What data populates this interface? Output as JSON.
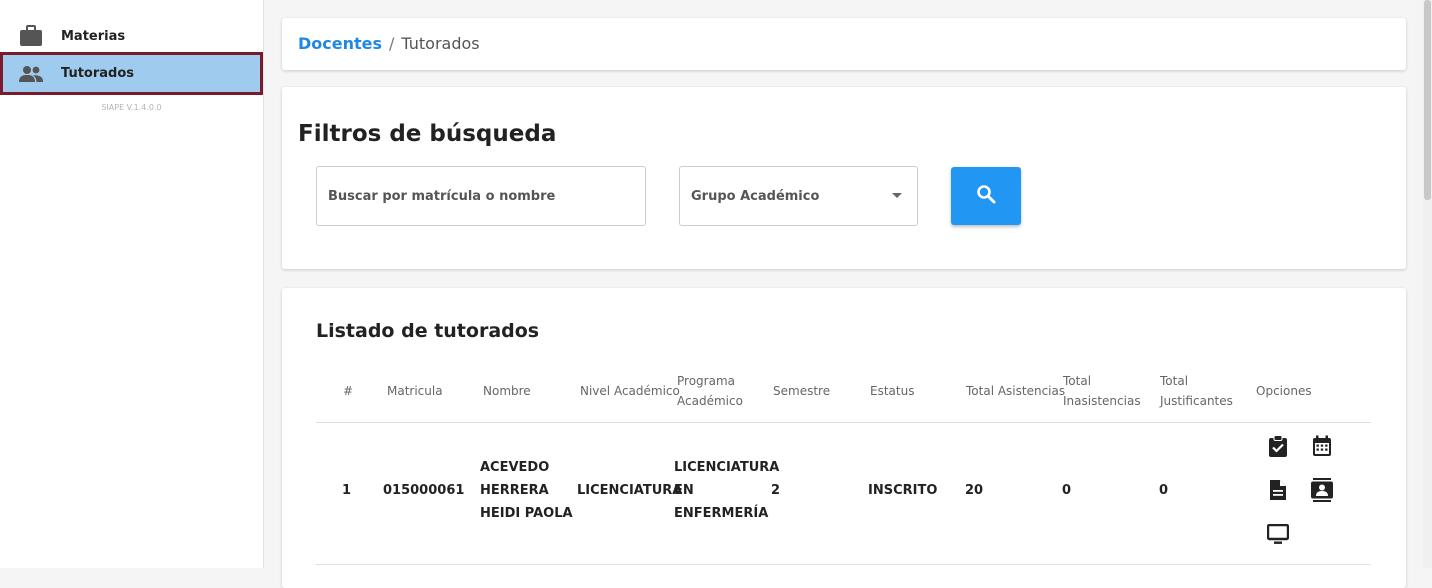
{
  "sidebar": {
    "items": [
      {
        "label": "Materias",
        "icon": "briefcase-icon"
      },
      {
        "label": "Tutorados",
        "icon": "people-icon",
        "active": true
      }
    ],
    "version": "SIAPE V.1.4.0.0"
  },
  "breadcrumb": {
    "parent": "Docentes",
    "separator": "/",
    "current": "Tutorados"
  },
  "filters": {
    "title": "Filtros de búsqueda",
    "search_placeholder": "Buscar por matrícula o nombre",
    "group_placeholder": "Grupo Académico",
    "search_button_icon": "search-icon"
  },
  "list": {
    "title": "Listado de tutorados",
    "columns": [
      "#",
      "Matricula",
      "Nombre",
      "Nivel Académico",
      "Programa Académico",
      "Semestre",
      "Estatus",
      "Total Asistencias",
      "Total Inasistencias",
      "Total Justificantes",
      "Opciones"
    ],
    "rows": [
      {
        "num": "1",
        "matricula": "015000061",
        "nombre": [
          "ACEVEDO",
          "HERRERA",
          "HEIDI PAOLA"
        ],
        "nivel": "LICENCIATURA",
        "programa": [
          "LICENCIATURA",
          "EN",
          "ENFERMERÍA"
        ],
        "semestre": "2",
        "estatus": "INSCRITO",
        "asistencias": "20",
        "inasistencias": "0",
        "justificantes": "0",
        "options": [
          "clipboard-check-icon",
          "calendar-icon",
          "document-icon",
          "contact-card-icon",
          "monitor-icon"
        ]
      }
    ]
  },
  "colors": {
    "accent": "#2196f3",
    "active_bg": "#9fccee",
    "active_border": "#7a1b2b",
    "link": "#1e88e5"
  }
}
